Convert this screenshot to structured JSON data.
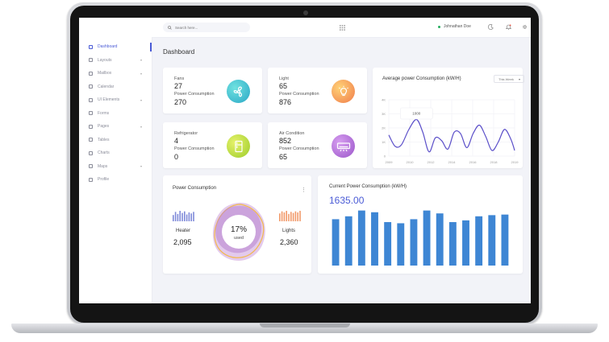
{
  "sidebar": {
    "items": [
      {
        "label": "Dashboard",
        "caret": ""
      },
      {
        "label": "Layouts",
        "caret": "▾"
      },
      {
        "label": "Mailbox",
        "caret": "▾"
      },
      {
        "label": "Calendar",
        "caret": ""
      },
      {
        "label": "UI Elements",
        "caret": "▾"
      },
      {
        "label": "Forms",
        "caret": ""
      },
      {
        "label": "Pages",
        "caret": "▾"
      },
      {
        "label": "Tables",
        "caret": ""
      },
      {
        "label": "Charts",
        "caret": ""
      },
      {
        "label": "Maps",
        "caret": "▾"
      },
      {
        "label": "Profile",
        "caret": ""
      }
    ]
  },
  "topbar": {
    "search_placeholder": "Search here...",
    "user_name": "Johnathan Doe",
    "icons": [
      "search-icon",
      "grid-icon",
      "moon-icon",
      "bell-icon",
      "gear-icon"
    ]
  },
  "page": {
    "title": "Dashboard"
  },
  "kpis": [
    {
      "name": "Fans",
      "value": "27",
      "sub_label": "Power Consumption",
      "sub_value": "270",
      "icon": "fan-icon",
      "color": "#36c6c9"
    },
    {
      "name": "Light",
      "value": "65",
      "sub_label": "Power Consumption",
      "sub_value": "876",
      "icon": "bulb-icon",
      "color": "#f7a15a"
    },
    {
      "name": "Refrigerator",
      "value": "4",
      "sub_label": "Power Consumption",
      "sub_value": "0",
      "icon": "fridge-icon",
      "color": "#b8d43a"
    },
    {
      "name": "Air Condition",
      "value": "852",
      "sub_label": "Power Consumption",
      "sub_value": "65",
      "icon": "aircon-icon",
      "color": "#b06ed6"
    }
  ],
  "avg_chart": {
    "title": "Average power Consumption (kW/H)",
    "filter": "This Week",
    "tooltip": "1000"
  },
  "power_card": {
    "title": "Power Consumption",
    "percent": "17%",
    "percent_label": "used",
    "heater_label": "Heater",
    "heater_value": "2,095",
    "lights_label": "Lights",
    "lights_value": "2,360"
  },
  "current_card": {
    "title": "Current Power Consumption (kW/H)",
    "value": "1635.00"
  },
  "chart_data": [
    {
      "type": "line",
      "title": "Average power Consumption (kW/H)",
      "x_ticks": [
        "2009",
        "2010",
        "2012",
        "2014",
        "2016",
        "2018",
        "2019"
      ],
      "y_ticks": [
        "0",
        "1K",
        "2K",
        "3K",
        "4K"
      ],
      "ylim": [
        0,
        4000
      ],
      "xlim": [
        2009,
        2019
      ],
      "x": [
        2009,
        2009.5,
        2010,
        2010.6,
        2011.2,
        2011.7,
        2012.2,
        2012.7,
        2013.2,
        2013.7,
        2014.2,
        2014.7,
        2015.2,
        2015.7,
        2016.2,
        2016.7,
        2017.2,
        2017.7,
        2018.2,
        2018.7,
        2019
      ],
      "values": [
        1500,
        700,
        800,
        1900,
        2600,
        1700,
        300,
        1300,
        1100,
        500,
        1700,
        1600,
        600,
        1600,
        2200,
        1400,
        400,
        1000,
        1900,
        1200,
        400
      ],
      "grid": true
    },
    {
      "type": "bar",
      "title": "Current Power Consumption (kW/H)",
      "values": [
        80,
        85,
        95,
        92,
        75,
        73,
        80,
        95,
        90,
        75,
        78,
        85,
        87,
        88
      ]
    },
    {
      "type": "bar",
      "title": "Heater",
      "values": [
        60,
        90,
        70,
        100,
        80,
        95,
        65,
        85,
        75,
        90
      ]
    },
    {
      "type": "bar",
      "title": "Lights",
      "values": [
        75,
        95,
        85,
        100,
        70,
        90,
        80,
        95,
        85,
        100
      ]
    }
  ]
}
